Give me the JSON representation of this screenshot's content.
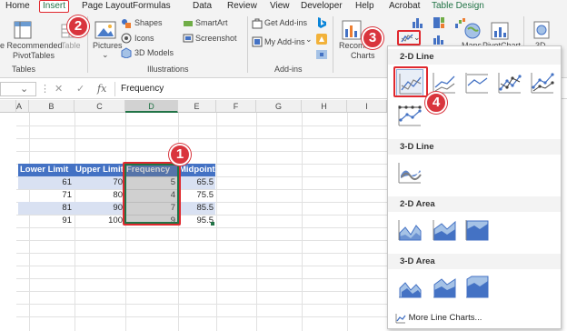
{
  "tabs": [
    "Home",
    "Insert",
    "Page Layout",
    "Formulas",
    "Data",
    "Review",
    "View",
    "Developer",
    "Help",
    "Acrobat",
    "Table Design"
  ],
  "ribbon": {
    "recommended_pivot": [
      "e Recommended",
      "PivotTables"
    ],
    "table": "Table",
    "pictures": "Pictures",
    "shapes": "Shapes",
    "icons": "Icons",
    "models": "3D Models",
    "smartart": "SmartArt",
    "screenshot": "Screenshot",
    "get_addins": "Get Add-ins",
    "my_addins": "My Add-ins",
    "recommended_charts": [
      "Recomm",
      "Charts"
    ],
    "maps": "Maps",
    "pivotchart": "PivotChart",
    "map3d": "3D",
    "groups": {
      "tables": "Tables",
      "illustrations": "Illustrations",
      "addins": "Add-ins"
    }
  },
  "formula_bar": {
    "cancel": "✕",
    "enter": "✓",
    "fx": "fx",
    "content": "Frequency"
  },
  "columns": [
    "A",
    "B",
    "C",
    "D",
    "E",
    "F",
    "G",
    "H",
    "I"
  ],
  "table": {
    "headers": [
      "Lower Limit",
      "Upper Limit",
      "Frequency",
      "Midpoint"
    ],
    "rows": [
      [
        "61",
        "70",
        "5",
        "65.5"
      ],
      [
        "71",
        "80",
        "4",
        "75.5"
      ],
      [
        "81",
        "90",
        "7",
        "85.5"
      ],
      [
        "91",
        "100",
        "9",
        "95.5"
      ]
    ]
  },
  "callouts": [
    "1",
    "2",
    "3",
    "4"
  ],
  "dropdown": {
    "sections": [
      "2-D Line",
      "3-D Line",
      "2-D Area",
      "3-D Area"
    ],
    "more": "More Line Charts..."
  },
  "colors": {
    "accent_green": "#217346",
    "table_header": "#4472c4",
    "band": "#d9e1f2",
    "callout_red": "#d9353d",
    "chart_blue": "#4472c4"
  }
}
